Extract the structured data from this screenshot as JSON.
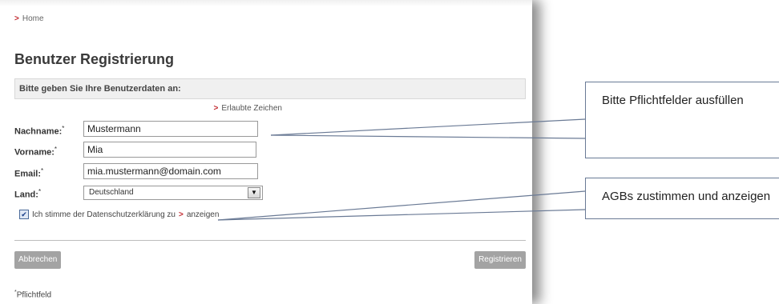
{
  "breadcrumb": {
    "home": "Home"
  },
  "title": "Benutzer Registrierung",
  "section_heading": "Bitte geben Sie Ihre Benutzerdaten an:",
  "allowed_chars_link": "Erlaubte Zeichen",
  "fields": {
    "lastname_label": "Nachname:",
    "lastname_value": "Mustermann",
    "firstname_label": "Vorname:",
    "firstname_value": "Mia",
    "email_label": "Email:",
    "email_value": "mia.mustermann@domain.com",
    "country_label": "Land:",
    "country_value": "Deutschland",
    "required_mark": "*"
  },
  "privacy": {
    "checked": true,
    "text": "Ich stimme der Datenschutzerklärung zu",
    "link": "anzeigen"
  },
  "buttons": {
    "cancel": "Abbrechen",
    "register": "Registrieren"
  },
  "footnote": {
    "mark": "*",
    "text": "Pflichtfeld"
  },
  "callouts": {
    "required": "Bitte Pflichtfelder ausfüllen",
    "terms": "AGBs zustimmen und anzeigen"
  },
  "colors": {
    "accent_red": "#c0272d",
    "button_gray": "#a3a3a3",
    "callout_line": "#6a7a95"
  }
}
